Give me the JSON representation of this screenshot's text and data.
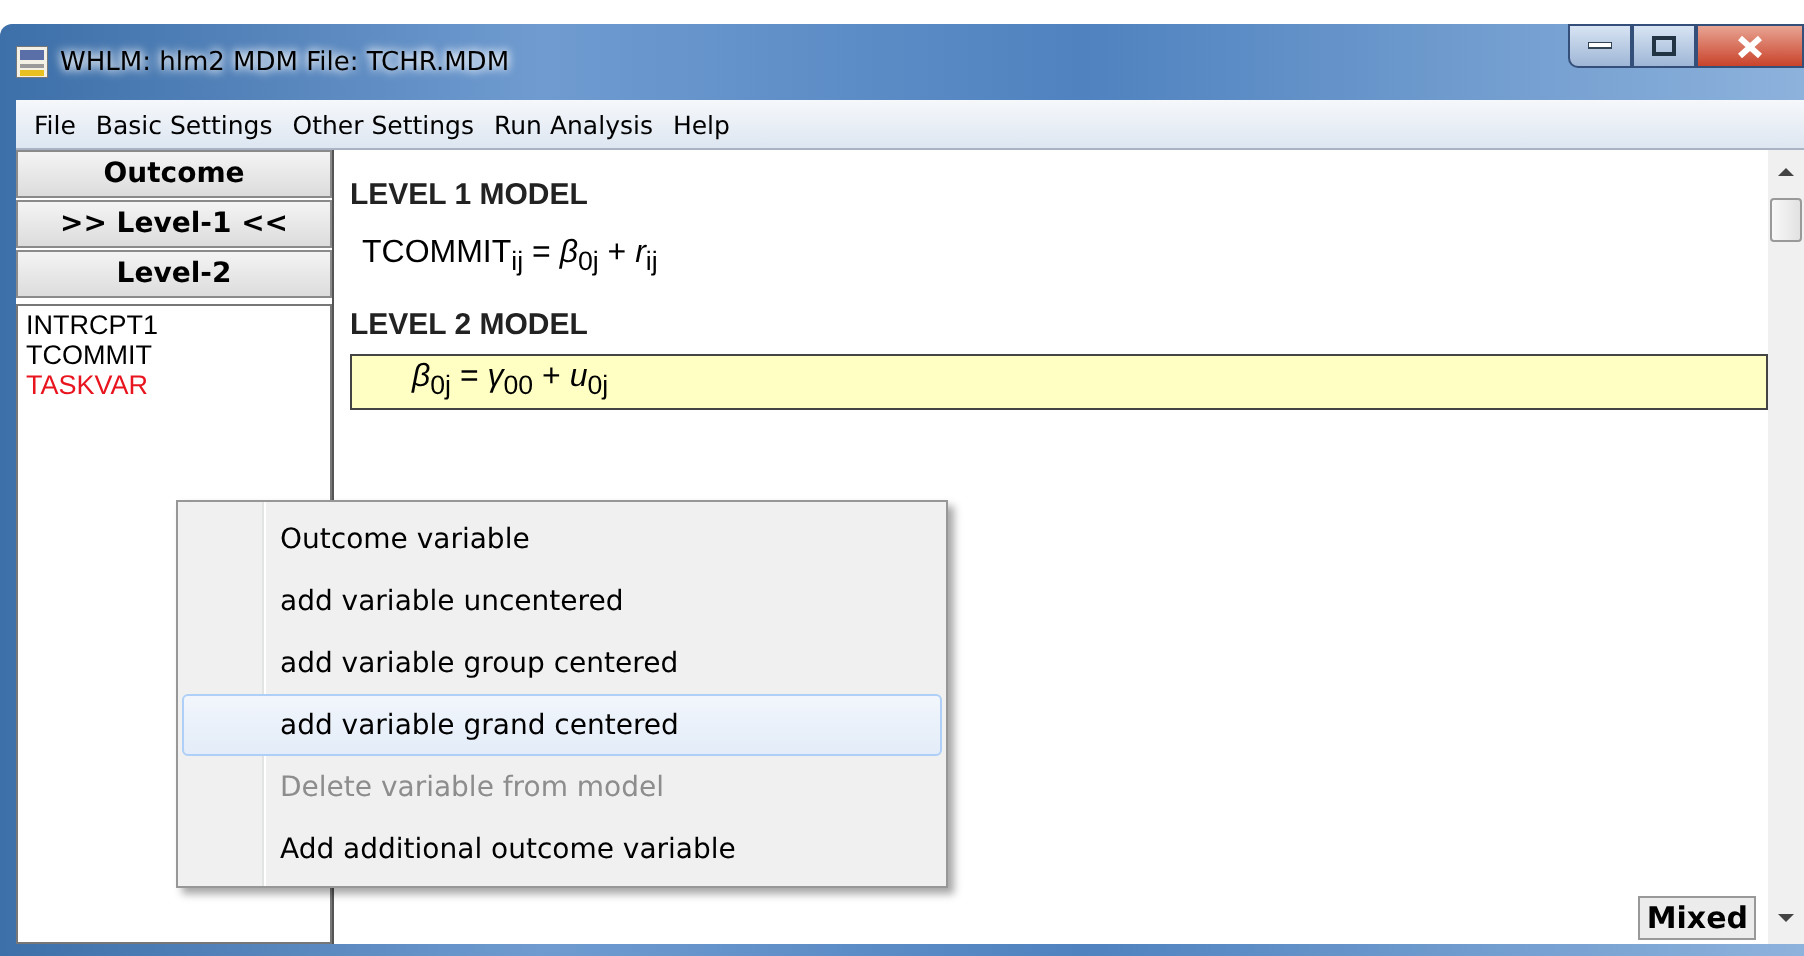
{
  "window": {
    "title": "WHLM: hlm2 MDM File: TCHR.MDM"
  },
  "menu": [
    "File",
    "Basic Settings",
    "Other Settings",
    "Run Analysis",
    "Help"
  ],
  "level_buttons": [
    {
      "label": "Outcome"
    },
    {
      "label": ">> Level-1 <<"
    },
    {
      "label": "Level-2"
    }
  ],
  "variables": [
    {
      "name": "INTRCPT1",
      "color": "#000000"
    },
    {
      "name": "TCOMMIT",
      "color": "#000000"
    },
    {
      "name": "TASKVAR",
      "color": "#e8141e"
    }
  ],
  "model": {
    "level1_heading": "LEVEL 1 MODEL",
    "level1_equation": "TCOMMIT$_{ij}$  =  *β*$_{0j}$ + *r*$_{ij}$",
    "level2_heading": "LEVEL 2 MODEL",
    "level2_equation": "*β*$_{0j}$  =  *γ*$_{00}$ + *u*$_{0j}$"
  },
  "context_menu": [
    {
      "label": "Outcome variable",
      "selected": false,
      "disabled": false
    },
    {
      "label": "add variable uncentered",
      "selected": false,
      "disabled": false
    },
    {
      "label": "add variable group centered",
      "selected": false,
      "disabled": false
    },
    {
      "label": "add variable grand centered",
      "selected": true,
      "disabled": false
    },
    {
      "label": "Delete variable from model",
      "selected": false,
      "disabled": true
    },
    {
      "label": "Add additional outcome variable",
      "selected": false,
      "disabled": false
    }
  ],
  "mixed_button": "Mixed"
}
